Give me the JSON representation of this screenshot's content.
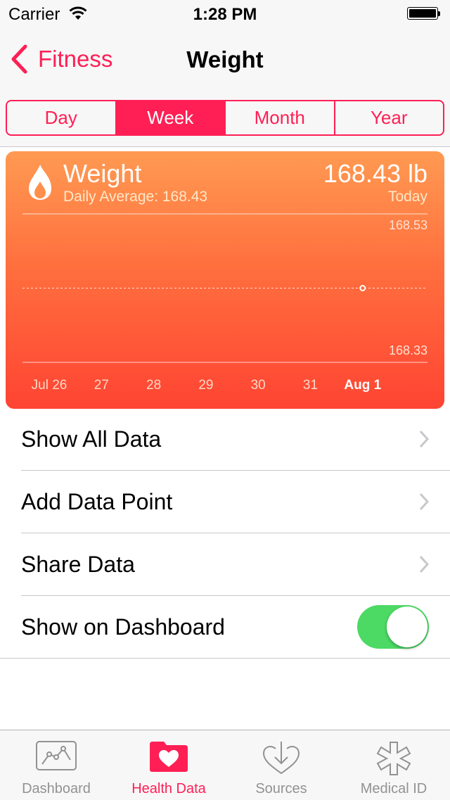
{
  "status_bar": {
    "carrier": "Carrier",
    "time": "1:28 PM"
  },
  "nav": {
    "back_label": "Fitness",
    "title": "Weight"
  },
  "segments": [
    {
      "label": "Day",
      "active": false
    },
    {
      "label": "Week",
      "active": true
    },
    {
      "label": "Month",
      "active": false
    },
    {
      "label": "Year",
      "active": false
    }
  ],
  "card": {
    "title": "Weight",
    "subtitle": "Daily Average: 168.43",
    "value": "168.43 lb",
    "date_label": "Today",
    "icon": "flame-icon"
  },
  "chart_data": {
    "type": "scatter",
    "x_labels": [
      "Jul 26",
      "27",
      "28",
      "29",
      "30",
      "31",
      "Aug 1"
    ],
    "highlighted_x": "Aug 1",
    "points": [
      {
        "x": "Aug 1",
        "y": 168.43
      }
    ],
    "average": 168.43,
    "y_tick_labels": [
      "168.53",
      "168.33"
    ],
    "ylim": [
      168.33,
      168.53
    ]
  },
  "list_items": [
    {
      "label": "Show All Data"
    },
    {
      "label": "Add Data Point"
    },
    {
      "label": "Share Data"
    }
  ],
  "dashboard_toggle": {
    "label": "Show on Dashboard",
    "on": true
  },
  "tabs": [
    {
      "label": "Dashboard",
      "icon": "dashboard-chart-icon",
      "active": false
    },
    {
      "label": "Health Data",
      "icon": "health-data-folder-icon",
      "active": true
    },
    {
      "label": "Sources",
      "icon": "sources-heart-icon",
      "active": false
    },
    {
      "label": "Medical ID",
      "icon": "medical-id-icon",
      "active": false
    }
  ],
  "colors": {
    "accent": "#ff1f55",
    "card_top": "#ff9a52",
    "card_bottom": "#ff4433",
    "toggle_on": "#4cd964"
  }
}
